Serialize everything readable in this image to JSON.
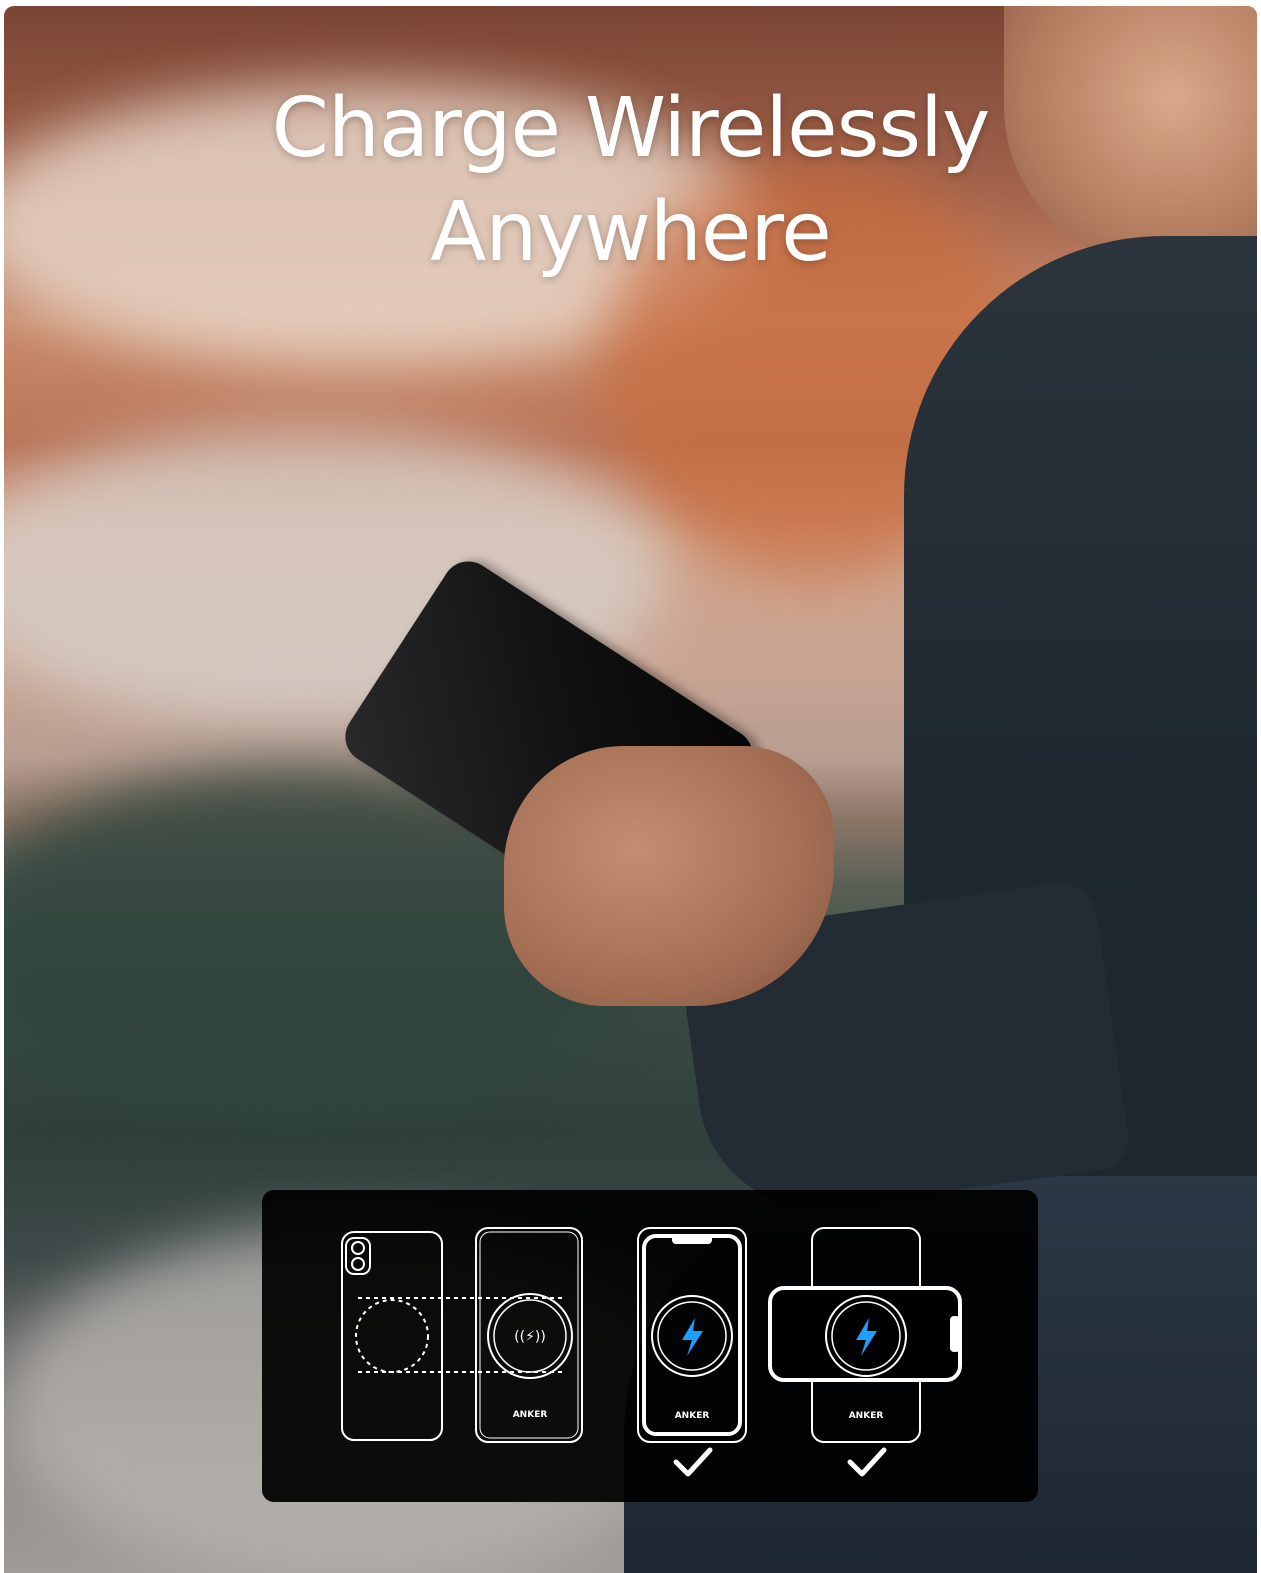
{
  "headline": {
    "line1": "Charge Wirelessly",
    "line2": "Anywhere"
  },
  "diagram": {
    "brand_text": "ANKER",
    "items": [
      {
        "name": "phone-back",
        "checked": false
      },
      {
        "name": "power-bank-front",
        "checked": false
      },
      {
        "name": "phone-on-bank-vertical",
        "checked": true
      },
      {
        "name": "phone-on-bank-horizontal",
        "checked": true
      }
    ],
    "accent_color": "#1ea0ff"
  }
}
